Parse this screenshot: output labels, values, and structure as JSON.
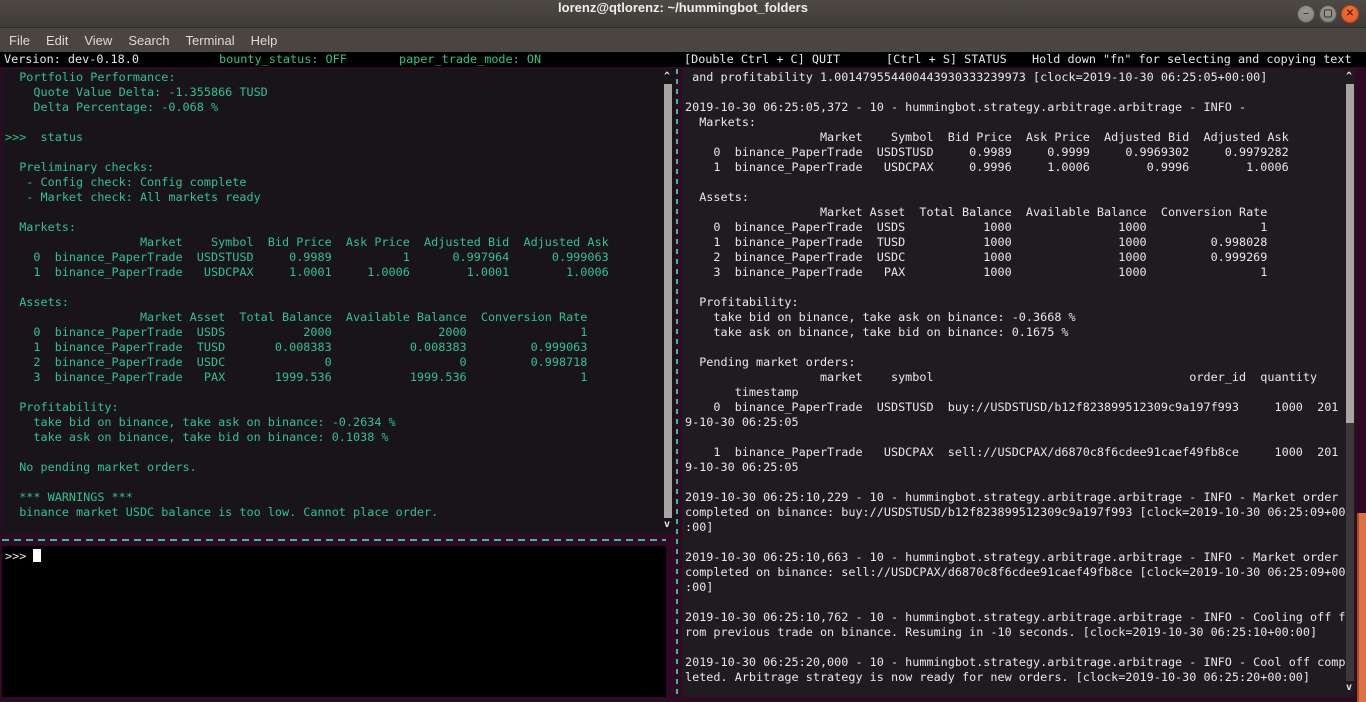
{
  "window": {
    "title": "lorenz@qtlorenz: ~/hummingbot_folders",
    "minimize_glyph": "–",
    "maximize_glyph": "▢",
    "close_glyph": "✕"
  },
  "menu": {
    "items": [
      "File",
      "Edit",
      "View",
      "Search",
      "Terminal",
      "Help"
    ]
  },
  "status_bar": {
    "version": "Version: dev-0.18.0",
    "bounty_status": "bounty_status: OFF",
    "paper_trade_mode": "paper_trade_mode: ON",
    "quit_hint": "[Double Ctrl + C] QUIT",
    "status_hint": "[Ctrl + S] STATUS",
    "copy_hint": "Hold down \"fn\" for selecting and copying text"
  },
  "left_pane": {
    "scroll_up": "^",
    "scroll_down": "v",
    "lines": [
      "  Portfolio Performance:",
      "    Quote Value Delta: -1.355866 TUSD",
      "    Delta Percentage: -0.068 %",
      "",
      ">>>  status",
      "",
      "  Preliminary checks:",
      "   - Config check: Config complete",
      "   - Market check: All markets ready",
      "",
      "  Markets:",
      "                   Market    Symbol  Bid Price  Ask Price  Adjusted Bid  Adjusted Ask",
      "    0  binance_PaperTrade  USDSTUSD     0.9989          1      0.997964      0.999063",
      "    1  binance_PaperTrade   USDCPAX     1.0001     1.0006        1.0001        1.0006",
      "",
      "  Assets:",
      "                   Market Asset  Total Balance  Available Balance  Conversion Rate",
      "    0  binance_PaperTrade  USDS           2000               2000                1",
      "    1  binance_PaperTrade  TUSD       0.008383           0.008383         0.999063",
      "    2  binance_PaperTrade  USDC              0                  0         0.998718",
      "    3  binance_PaperTrade   PAX       1999.536           1999.536                1",
      "",
      "  Profitability:",
      "    take bid on binance, take ask on binance: -0.2634 %",
      "    take ask on binance, take bid on binance: 0.1038 %",
      "",
      "  No pending market orders.",
      "",
      "  *** WARNINGS ***",
      "  binance market USDC balance is too low. Cannot place order."
    ]
  },
  "input_pane": {
    "prompt": ">>> "
  },
  "right_pane": {
    "scroll_up": "^",
    "scroll_down": "v",
    "lines": [
      " and profitability 1.001479554400443930333239973 [clock=2019-10-30 06:25:05+00:00]",
      "",
      "2019-10-30 06:25:05,372 - 10 - hummingbot.strategy.arbitrage.arbitrage - INFO - ",
      "  Markets:",
      "                   Market    Symbol  Bid Price  Ask Price  Adjusted Bid  Adjusted Ask",
      "    0  binance_PaperTrade  USDSTUSD     0.9989     0.9999     0.9969302     0.9979282",
      "    1  binance_PaperTrade   USDCPAX     0.9996     1.0006        0.9996        1.0006",
      "",
      "  Assets:",
      "                   Market Asset  Total Balance  Available Balance  Conversion Rate",
      "    0  binance_PaperTrade  USDS           1000               1000                1",
      "    1  binance_PaperTrade  TUSD           1000               1000         0.998028",
      "    2  binance_PaperTrade  USDC           1000               1000         0.999269",
      "    3  binance_PaperTrade   PAX           1000               1000                1",
      "",
      "  Profitability:",
      "    take bid on binance, take ask on binance: -0.3668 %",
      "    take ask on binance, take bid on binance: 0.1675 %",
      "",
      "  Pending market orders:",
      "                   market    symbol                                    order_id  quantity",
      "       timestamp",
      "    0  binance_PaperTrade  USDSTUSD  buy://USDSTUSD/b12f823899512309c9a197f993     1000  201",
      "9-10-30 06:25:05",
      "",
      "    1  binance_PaperTrade   USDCPAX  sell://USDCPAX/d6870c8f6cdee91caef49fb8ce     1000  201",
      "9-10-30 06:25:05",
      "",
      "2019-10-30 06:25:10,229 - 10 - hummingbot.strategy.arbitrage.arbitrage - INFO - Market order ",
      "completed on binance: buy://USDSTUSD/b12f823899512309c9a197f993 [clock=2019-10-30 06:25:09+00",
      ":00]",
      "",
      "2019-10-30 06:25:10,663 - 10 - hummingbot.strategy.arbitrage.arbitrage - INFO - Market order ",
      "completed on binance: sell://USDCPAX/d6870c8f6cdee91caef49fb8ce [clock=2019-10-30 06:25:09+00",
      ":00]",
      "",
      "2019-10-30 06:25:10,762 - 10 - hummingbot.strategy.arbitrage.arbitrage - INFO - Cooling off f",
      "rom previous trade on binance. Resuming in -10 seconds. [clock=2019-10-30 06:25:10+00:00]",
      "",
      "2019-10-30 06:25:20,000 - 10 - hummingbot.strategy.arbitrage.arbitrage - INFO - Cool off comp",
      "leted. Arbitrage strategy is now ready for new orders. [clock=2019-10-30 06:25:20+00:00]"
    ]
  },
  "tables": {
    "status_markets": {
      "headers": [
        "",
        "Market",
        "Symbol",
        "Bid Price",
        "Ask Price",
        "Adjusted Bid",
        "Adjusted Ask"
      ],
      "rows": [
        [
          "0",
          "binance_PaperTrade",
          "USDSTUSD",
          "0.9989",
          "1",
          "0.997964",
          "0.999063"
        ],
        [
          "1",
          "binance_PaperTrade",
          "USDCPAX",
          "1.0001",
          "1.0006",
          "1.0001",
          "1.0006"
        ]
      ]
    },
    "status_assets": {
      "headers": [
        "",
        "Market",
        "Asset",
        "Total Balance",
        "Available Balance",
        "Conversion Rate"
      ],
      "rows": [
        [
          "0",
          "binance_PaperTrade",
          "USDS",
          "2000",
          "2000",
          "1"
        ],
        [
          "1",
          "binance_PaperTrade",
          "TUSD",
          "0.008383",
          "0.008383",
          "0.999063"
        ],
        [
          "2",
          "binance_PaperTrade",
          "USDC",
          "0",
          "0",
          "0.998718"
        ],
        [
          "3",
          "binance_PaperTrade",
          "PAX",
          "1999.536",
          "1999.536",
          "1"
        ]
      ]
    },
    "log_markets": {
      "headers": [
        "",
        "Market",
        "Symbol",
        "Bid Price",
        "Ask Price",
        "Adjusted Bid",
        "Adjusted Ask"
      ],
      "rows": [
        [
          "0",
          "binance_PaperTrade",
          "USDSTUSD",
          "0.9989",
          "0.9999",
          "0.9969302",
          "0.9979282"
        ],
        [
          "1",
          "binance_PaperTrade",
          "USDCPAX",
          "0.9996",
          "1.0006",
          "0.9996",
          "1.0006"
        ]
      ]
    },
    "log_assets": {
      "headers": [
        "",
        "Market",
        "Asset",
        "Total Balance",
        "Available Balance",
        "Conversion Rate"
      ],
      "rows": [
        [
          "0",
          "binance_PaperTrade",
          "USDS",
          "1000",
          "1000",
          "1"
        ],
        [
          "1",
          "binance_PaperTrade",
          "TUSD",
          "1000",
          "1000",
          "0.998028"
        ],
        [
          "2",
          "binance_PaperTrade",
          "USDC",
          "1000",
          "1000",
          "0.999269"
        ],
        [
          "3",
          "binance_PaperTrade",
          "PAX",
          "1000",
          "1000",
          "1"
        ]
      ]
    },
    "pending_orders": {
      "headers": [
        "",
        "market",
        "symbol",
        "order_id",
        "quantity",
        "timestamp"
      ],
      "rows": [
        [
          "0",
          "binance_PaperTrade",
          "USDSTUSD",
          "buy://USDSTUSD/b12f823899512309c9a197f993",
          "1000",
          "2019-10-30 06:25:05"
        ],
        [
          "1",
          "binance_PaperTrade",
          "USDCPAX",
          "sell://USDCPAX/d6870c8f6cdee91caef49fb8ce",
          "1000",
          "2019-10-30 06:25:05"
        ]
      ]
    }
  },
  "colors": {
    "terminal_bg": "#300a24",
    "pane_bg": "#18141a",
    "log_bg": "#201b21",
    "input_bg": "#000000",
    "green": "#2bc48d",
    "white_text": "#e8e6e8",
    "divider": "#2bc48d",
    "scroll_thumb": "#a9a5a2",
    "scroll_track": "#3b383b",
    "overlay_scrollbar": "#de7247"
  }
}
